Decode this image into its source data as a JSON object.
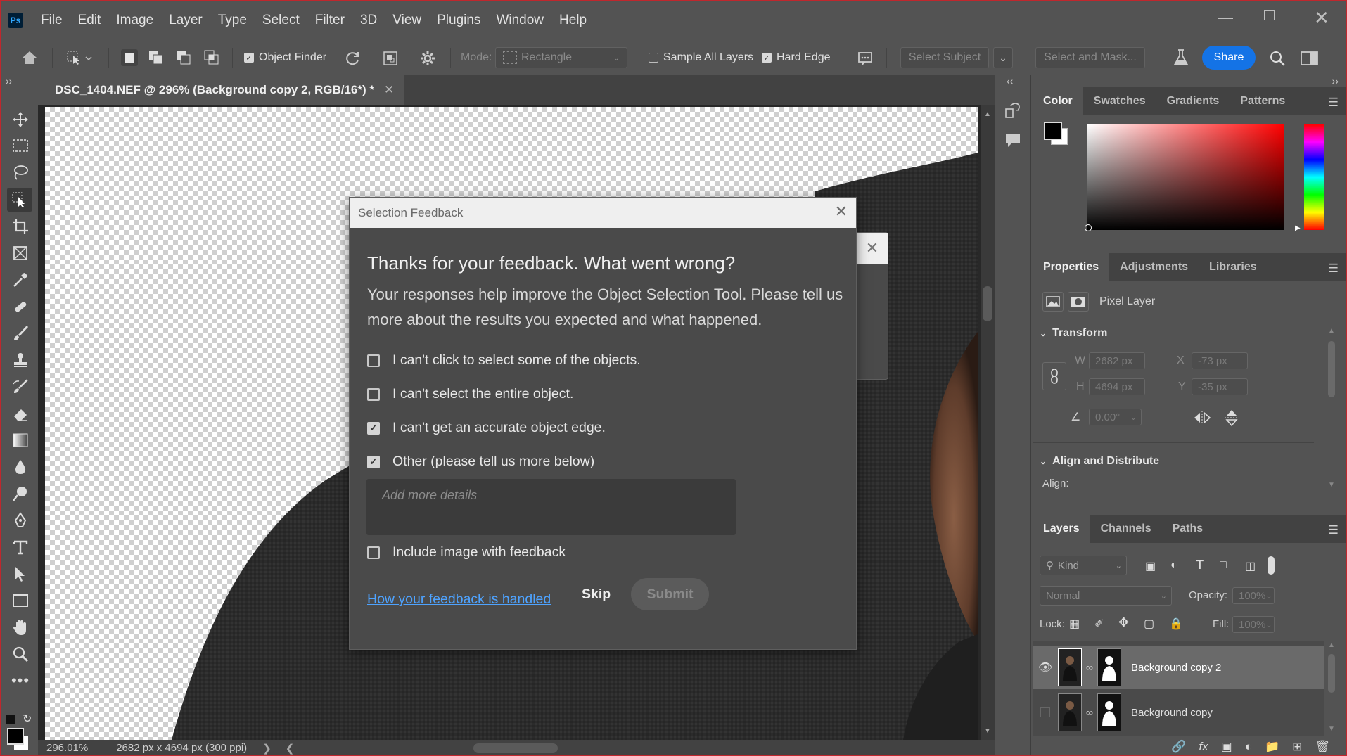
{
  "menubar": {
    "logo": "Ps",
    "items": [
      "File",
      "Edit",
      "Image",
      "Layer",
      "Type",
      "Select",
      "Filter",
      "3D",
      "View",
      "Plugins",
      "Window",
      "Help"
    ]
  },
  "options": {
    "object_finder": "Object Finder",
    "mode_label": "Mode:",
    "mode_value": "Rectangle",
    "sample_all_layers": "Sample All Layers",
    "hard_edge": "Hard Edge",
    "select_subject": "Select Subject",
    "select_and_mask": "Select and Mask...",
    "share": "Share"
  },
  "document": {
    "tab_title": "DSC_1404.NEF @ 296% (Background copy 2, RGB/16*) *",
    "zoom": "296.01%",
    "dimensions": "2682 px x 4694 px (300 ppi)"
  },
  "dialog": {
    "title": "Selection Feedback",
    "heading": "Thanks for your feedback. What went wrong?",
    "description": "Your responses help improve the Object Selection Tool. Please tell us more about the results you expected and what happened.",
    "options": [
      {
        "label": "I can't click to select some of the objects.",
        "checked": false
      },
      {
        "label": "I can't select the entire object.",
        "checked": false
      },
      {
        "label": "I can't get an accurate object edge.",
        "checked": true
      },
      {
        "label": "Other (please tell us more below)",
        "checked": true
      }
    ],
    "details_placeholder": "Add more details",
    "include_image": {
      "label": "Include image with feedback",
      "checked": false
    },
    "link": "How your feedback is handled",
    "skip": "Skip",
    "submit": "Submit"
  },
  "color_panel": {
    "tabs": [
      "Color",
      "Swatches",
      "Gradients",
      "Patterns"
    ]
  },
  "properties_panel": {
    "tabs": [
      "Properties",
      "Adjustments",
      "Libraries"
    ],
    "layer_type": "Pixel Layer",
    "transform_title": "Transform",
    "w_label": "W",
    "w_value": "2682 px",
    "x_label": "X",
    "x_value": "-73 px",
    "h_label": "H",
    "h_value": "4694 px",
    "y_label": "Y",
    "y_value": "-35 px",
    "angle_value": "0.00°",
    "align_title": "Align and Distribute",
    "align_label": "Align:"
  },
  "layers_panel": {
    "tabs": [
      "Layers",
      "Channels",
      "Paths"
    ],
    "filter_kind": "Kind",
    "blend_mode": "Normal",
    "opacity_label": "Opacity:",
    "opacity_value": "100%",
    "lock_label": "Lock:",
    "fill_label": "Fill:",
    "fill_value": "100%",
    "layers": [
      {
        "name": "Background copy 2",
        "visible": true,
        "selected": true
      },
      {
        "name": "Background copy",
        "visible": false,
        "selected": false
      }
    ]
  }
}
